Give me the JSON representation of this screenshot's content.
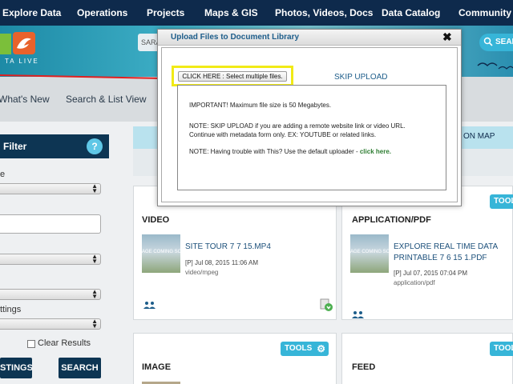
{
  "topnav": {
    "items": [
      "Explore Data",
      "Operations",
      "Projects",
      "Maps & GIS",
      "Photos, Videos, Docs",
      "Data Catalog",
      "Community"
    ]
  },
  "banner": {
    "logo_text": "TA LIVE",
    "search_text": "SARA",
    "search_button": "SEAR"
  },
  "subnav": {
    "items": [
      "What's New",
      "Search & List View"
    ]
  },
  "filter": {
    "title": "Filter",
    "help": "?",
    "labels": [
      "e",
      "ttings"
    ],
    "clear_results": "Clear Results",
    "settings_button": "STINGS",
    "search_button": "SEARCH"
  },
  "main": {
    "on_map": "ON MAP",
    "cards": [
      {
        "title": "VIDEO",
        "file_name": "SITE TOUR 7 7 15.MP4",
        "date": "[P] Jul 08, 2015 11:06 AM",
        "mime": "video/mpeg",
        "thumb_text": "AGE COMING SO"
      },
      {
        "title": "APPLICATION/PDF",
        "tools": "TOOL",
        "file_name_1": "EXPLORE REAL TIME DATA",
        "file_name_2": "PRINTABLE 7 6 15 1.PDF",
        "date": "[P] Jul 07, 2015 07:04 PM",
        "mime": "application/pdf",
        "thumb_text": "AGE COMING SO"
      },
      {
        "title": "IMAGE",
        "tools": "TOOLS"
      },
      {
        "title": "FEED",
        "tools": "TOOL"
      }
    ]
  },
  "modal": {
    "title": "Upload Files to Document Library",
    "close": "✖",
    "select_button": "CLICK HERE : Select multiple files.",
    "skip_upload": "SKIP UPLOAD",
    "important": "IMPORTANT! Maximum file size is 50 Megabytes.",
    "note1": "NOTE: SKIP UPLOAD if you are adding a remote website link or video URL.",
    "note1b": "Continue with metadata form only. EX: YOUTUBE or related links.",
    "note2": "NOTE: Having trouble with This? Use the default uploader -",
    "note2_link": "click here."
  },
  "colors": {
    "nav_dark": "#0e2a4c",
    "accent": "#37b5d8",
    "highlight": "#f1ea16",
    "arrow": "#e02020",
    "link_green": "#2e7d32"
  },
  "icons": [
    "search-icon",
    "help-icon",
    "close-icon",
    "gear-icon",
    "people-icon",
    "download-icon",
    "bird-logo-icon"
  ]
}
